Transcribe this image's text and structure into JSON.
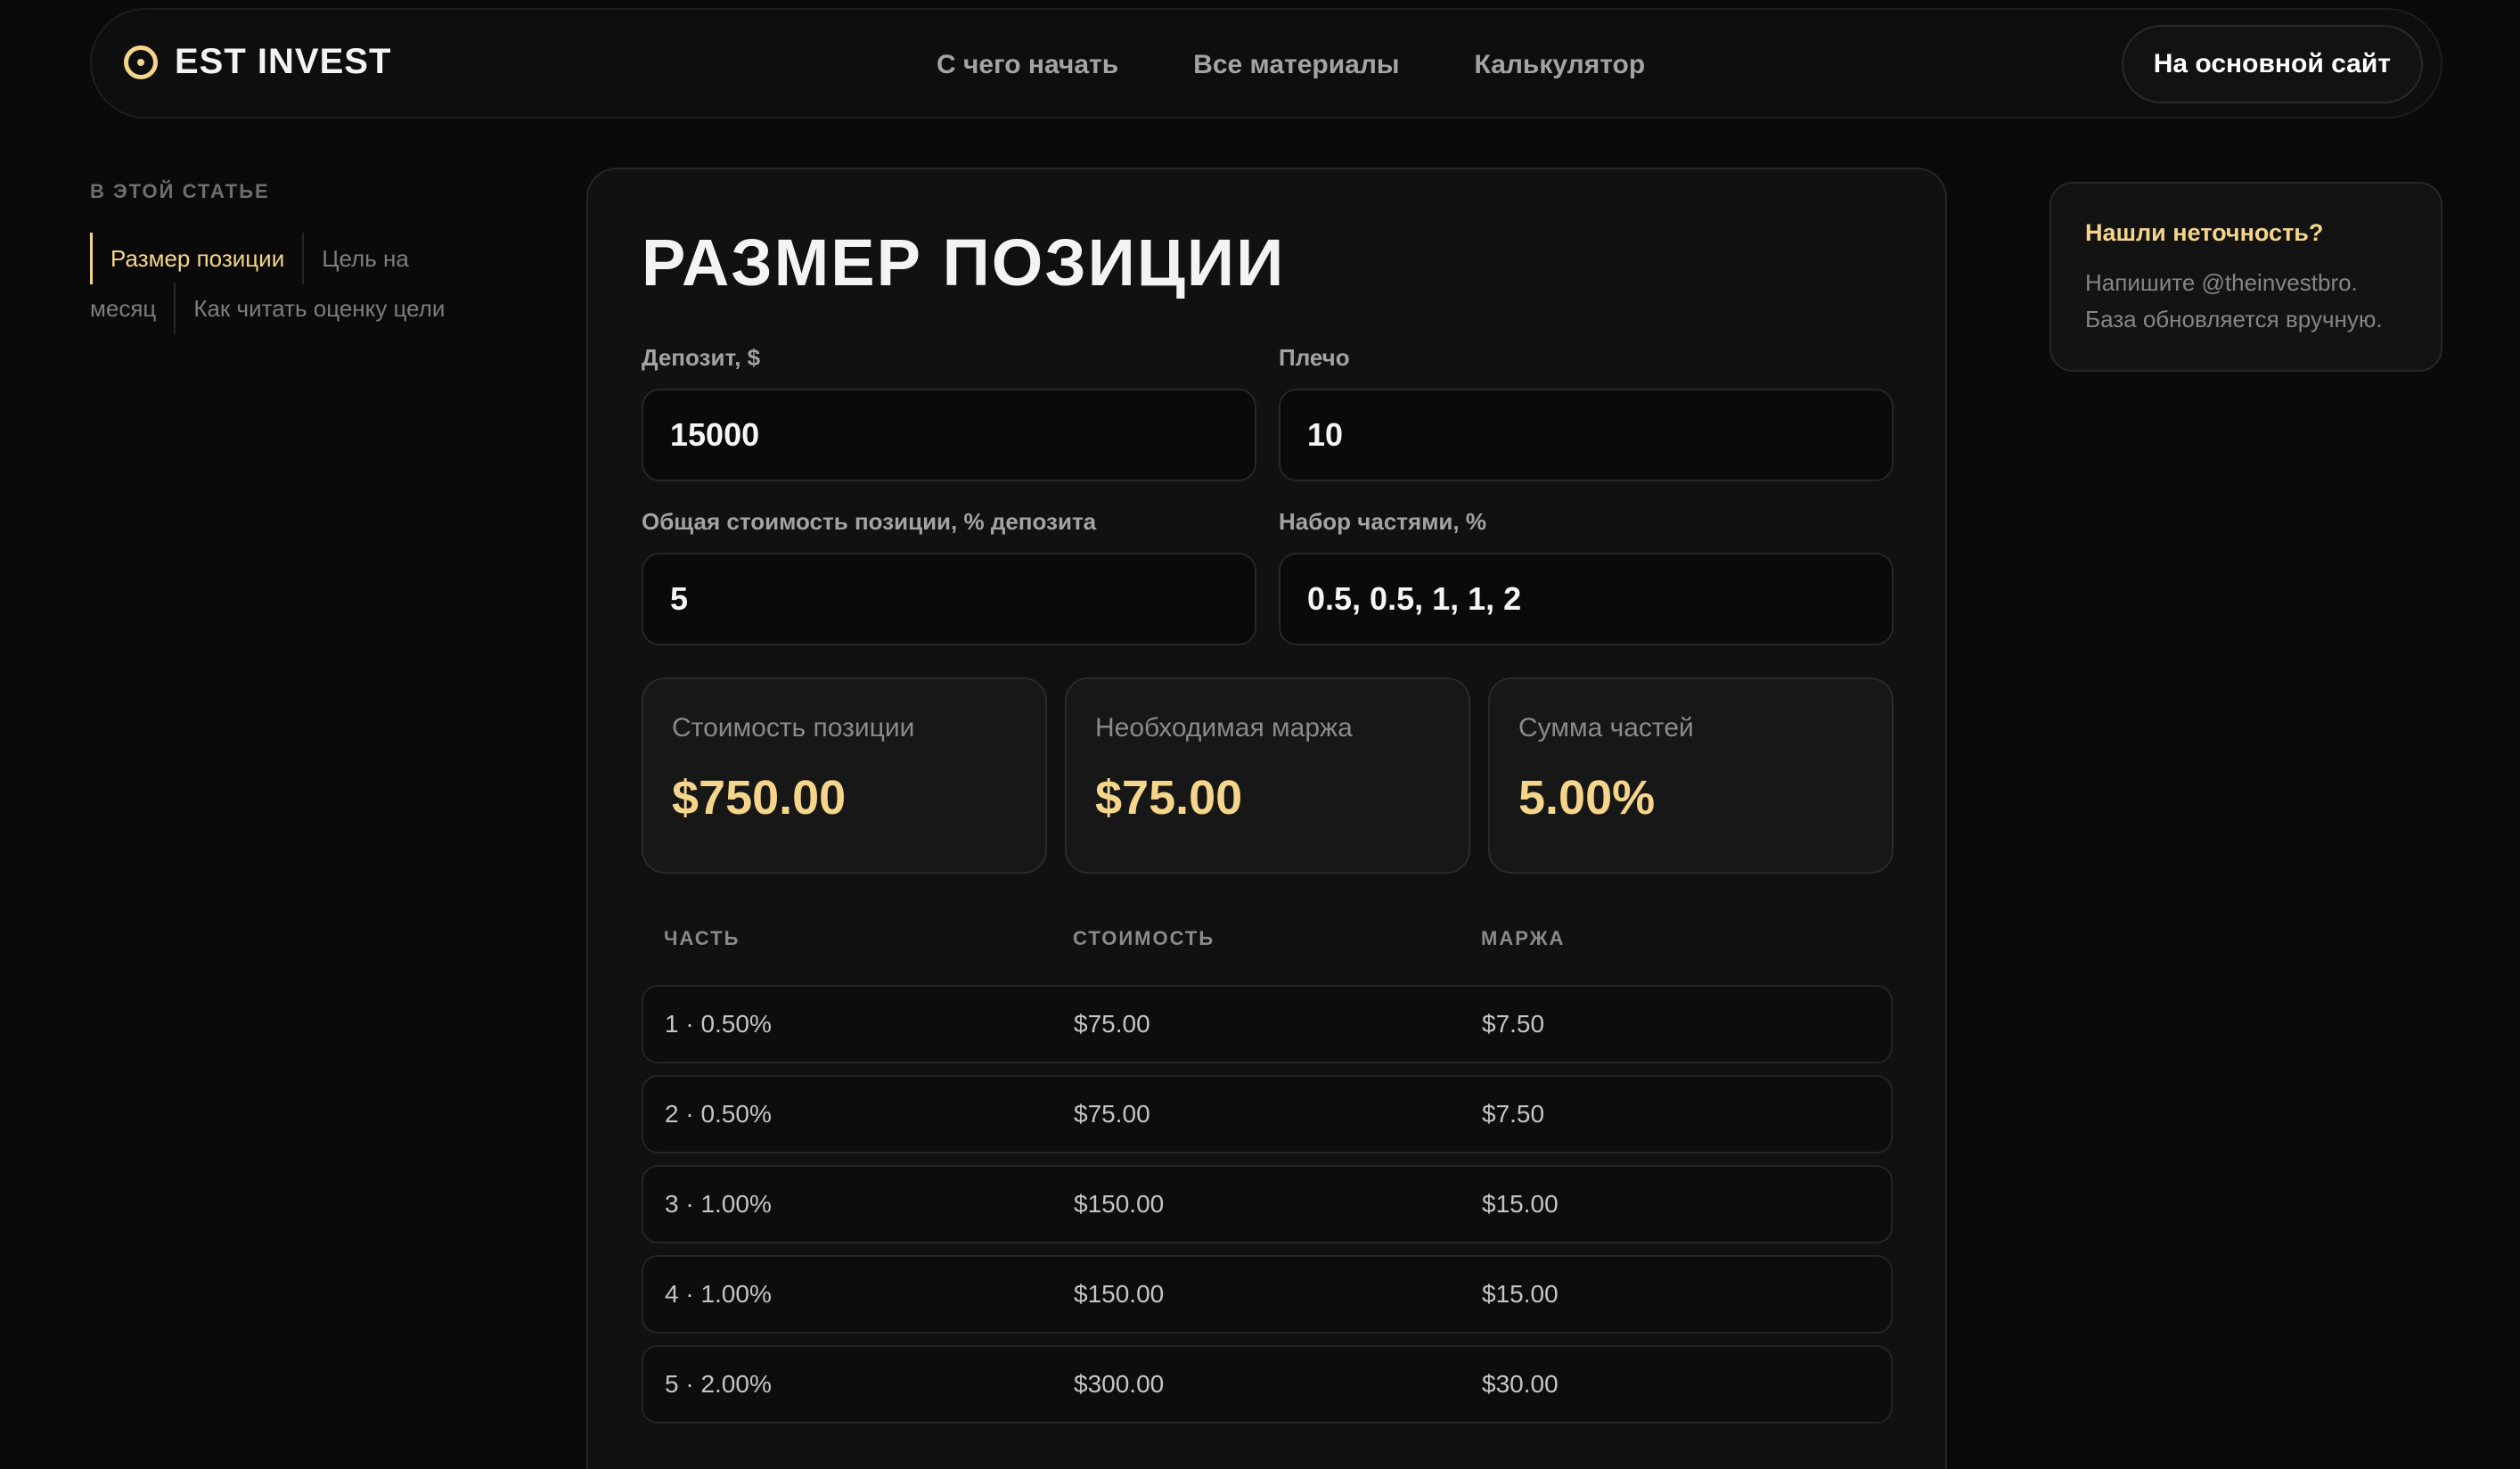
{
  "header": {
    "logo_text": "EST INVEST",
    "nav": [
      {
        "label": "С чего начать"
      },
      {
        "label": "Все материалы"
      },
      {
        "label": "Калькулятор"
      }
    ],
    "main_site_button": "На основной сайт"
  },
  "toc": {
    "heading": "В ЭТОЙ СТАТЬЕ",
    "items": [
      {
        "label": "Размер позиции",
        "active": true
      },
      {
        "label": "Цель на месяц",
        "active": false
      },
      {
        "label": "Как читать оценку цели",
        "active": false
      }
    ]
  },
  "calculator": {
    "title": "Размер позиции",
    "fields": {
      "deposit": {
        "label": "Депозит, $",
        "value": "15000"
      },
      "leverage": {
        "label": "Плечо",
        "value": "10"
      },
      "position_pct": {
        "label": "Общая стоимость позиции, % депозита",
        "value": "5"
      },
      "parts": {
        "label": "Набор частями, %",
        "value": "0.5, 0.5, 1, 1, 2"
      }
    },
    "stats": [
      {
        "label": "Стоимость позиции",
        "value": "$750.00"
      },
      {
        "label": "Необходимая маржа",
        "value": "$75.00"
      },
      {
        "label": "Сумма частей",
        "value": "5.00%"
      }
    ],
    "table": {
      "columns": [
        "ЧАСТЬ",
        "СТОИМОСТЬ",
        "МАРЖА"
      ],
      "rows": [
        {
          "part": "1 · 0.50%",
          "cost": "$75.00",
          "margin": "$7.50"
        },
        {
          "part": "2 · 0.50%",
          "cost": "$75.00",
          "margin": "$7.50"
        },
        {
          "part": "3 · 1.00%",
          "cost": "$150.00",
          "margin": "$15.00"
        },
        {
          "part": "4 · 1.00%",
          "cost": "$150.00",
          "margin": "$15.00"
        },
        {
          "part": "5 · 2.00%",
          "cost": "$300.00",
          "margin": "$30.00"
        }
      ]
    }
  },
  "feedback": {
    "title": "Нашли неточность?",
    "text": "Напишите @theinvestbro. База обновляется вручную."
  },
  "colors": {
    "accent": "#f5d58a",
    "background": "#0a0a0a",
    "card": "#111111"
  }
}
